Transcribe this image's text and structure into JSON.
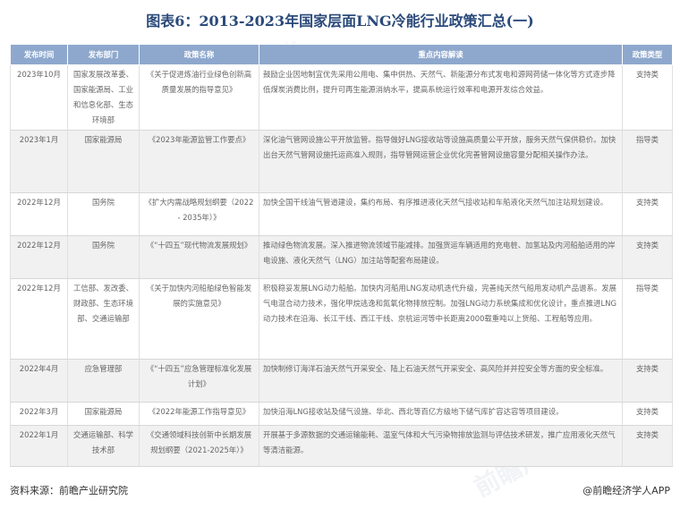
{
  "title": "图表6：2013-2023年国家层面LNG冷能行业政策汇总(一)",
  "table": {
    "headers": [
      "发布时间",
      "发布部门",
      "政策名称",
      "重点内容解读",
      "政策类型"
    ],
    "rows": [
      {
        "date": "2023年10月",
        "dept": "国家发展改革委、国家能源局、工业和信息化部、生态环境部",
        "name": "《关于促进炼油行业绿色创新高质量发展的指导意见》",
        "content": "鼓励企业因地制宜优先采用公用电、集中供热、天然气、新能源分布式发电和源网荷储一体化等方式逐步降低煤炭消费比例，提升可再生能源消纳水平，提高系统运行效率和电源开发综合效益。",
        "type": "支持类"
      },
      {
        "date": "2023年1月",
        "dept": "国家能源局",
        "name": "《2023年能源监管工作要点》",
        "content": "深化油气管网设施公平开放监管。指导做好LNG接收站等设施高质量公平开放，服务天然气保供稳价。加快出台天然气管网设施托运商准入规则，指导管网运营企业优化完善管网设施容量分配相关操作办法。",
        "type": "指导类"
      },
      {
        "date": "2022年12月",
        "dept": "国务院",
        "name": "《扩大内需战略规划纲要（2022 - 2035年）》",
        "content": "加快全国干线油气管道建设，集约布局、有序推进液化天然气接收站和车船液化天然气加注站规划建设。",
        "type": "支持类"
      },
      {
        "date": "2022年12月",
        "dept": "国务院",
        "name": "《“十四五”现代物流发展规划》",
        "content": "推动绿色物流发展。深入推进物流领域节能减排。加强货运车辆适用的充电桩、加氢站及内河船舶适用的岸电设施、液化天然气（LNG）加注站等配套布局建设。",
        "type": "支持类"
      },
      {
        "date": "2022年12月",
        "dept": "工信部、发改委、财政部、生态环境部、交通运输部",
        "name": "《关于加快内河船舶绿色智能发展的实施意见》",
        "content": "积极稳妥发展LNG动力船舶。加快内河船用LNG发动机迭代升级，完善纯天然气船用发动机产品谱系。发展气电混合动力技术，强化甲烷逃逸和氮氧化物排放控制。加强LNG动力系统集成和优化设计，重点推进LNG动力技术在沿海、长江干线、西江干线、京杭运河等中长距离2000载重吨以上货船、工程船等应用。",
        "type": "指导类"
      },
      {
        "date": "2022年4月",
        "dept": "应急管理部",
        "name": "《“十四五”应急管理标准化发展计划》",
        "content": "加快制修订海洋石油天然气开采安全、陆上石油天然气开采安全、高风险并并控安全等方面的安全标准。",
        "type": "支持类"
      },
      {
        "date": "2022年3月",
        "dept": "国家能源局",
        "name": "《2022年能源工作指导意见》",
        "content": "加快沿海LNG接收站及储气设施、华北、西北等百亿方级地下储气库扩容达容等项目建设。",
        "type": "支持类"
      },
      {
        "date": "2022年1月",
        "dept": "交通运输部、科学技术部",
        "name": "《交通领域科技创新中长期发展规划纲要（2021-2025年）》",
        "content": "开展基于多源数据的交通运输能耗、温室气体和大气污染物排放监测与评估技术研发，推广应用液化天然气等清洁能源。",
        "type": "支持类"
      }
    ]
  },
  "footer": {
    "source": "资料来源：前瞻产业研究院",
    "brand": "@前瞻经济学人APP"
  },
  "watermark": "前瞻产业研究院"
}
